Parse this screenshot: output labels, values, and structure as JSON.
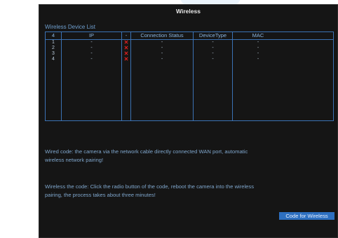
{
  "window": {
    "title": "Wireless"
  },
  "device_list": {
    "label": "Wireless Device List",
    "columns": [
      "4",
      "IP",
      "-",
      "Connection Status",
      "DeviceType",
      "MAC"
    ],
    "rows": [
      [
        "1",
        "-",
        "✕",
        "-",
        "-",
        "-"
      ],
      [
        "2",
        "-",
        "✕",
        "-",
        "-",
        "-"
      ],
      [
        "3",
        "-",
        "✕",
        "-",
        "-",
        "-"
      ],
      [
        "4",
        "-",
        "✕",
        "-",
        "-",
        "-"
      ]
    ],
    "status_icon": "red-x-icon",
    "status_color": "#e02020"
  },
  "info": {
    "wired_text": "Wired code: the camera via the network cable directly connected WAN port, automatic wireless network pairing!",
    "wireless_text": "Wireless the code: Click the radio button of the code, reboot the camera into the wireless pairing, the process takes about three minutes!"
  },
  "buttons": {
    "code_for_wireless": "Code for Wireless"
  },
  "colors": {
    "accent": "#2d6fc0",
    "border": "#3b72b4",
    "text": "#7fa6cc"
  }
}
